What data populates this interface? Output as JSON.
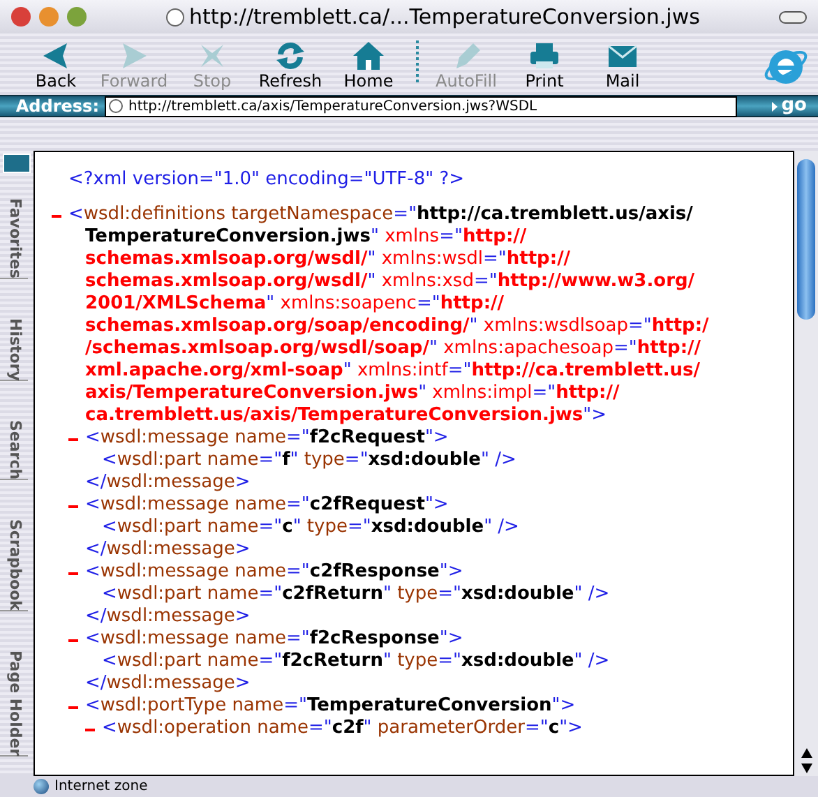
{
  "window": {
    "title": "http://tremblett.ca/...TemperatureConversion.jws"
  },
  "toolbar": [
    {
      "label": "Back",
      "kind": "back",
      "disabled": false
    },
    {
      "label": "Forward",
      "kind": "forward",
      "disabled": true
    },
    {
      "label": "Stop",
      "kind": "stop",
      "disabled": true
    },
    {
      "label": "Refresh",
      "kind": "refresh",
      "disabled": false
    },
    {
      "label": "Home",
      "kind": "home",
      "disabled": false
    },
    {
      "label": "AutoFill",
      "kind": "autofill",
      "disabled": true
    },
    {
      "label": "Print",
      "kind": "print",
      "disabled": false
    },
    {
      "label": "Mail",
      "kind": "mail",
      "disabled": false
    }
  ],
  "address": {
    "label": "Address:",
    "value": "http://tremblett.ca/axis/TemperatureConversion.jws?WSDL",
    "go": "go"
  },
  "sidebar_tabs": [
    {
      "label": "Favorites"
    },
    {
      "label": "History"
    },
    {
      "label": "Search"
    },
    {
      "label": "Scrapbook"
    },
    {
      "label": "Page Holder"
    }
  ],
  "document": [
    {
      "collapsible": false,
      "lines": [
        [
          {
            "kind": "tag",
            "text": "<?xml version=\"1.0\" encoding=\"UTF-8\" ?>"
          }
        ]
      ]
    },
    {
      "collapsible": true,
      "lines": [
        [
          {
            "kind": "tag",
            "text": "<"
          },
          {
            "kind": "attr",
            "text": "wsdl:definitions targetNamespace"
          },
          {
            "kind": "tag",
            "text": "=\""
          },
          {
            "kind": "value",
            "text": "http://ca.tremblett.us/axis/"
          }
        ],
        [
          {
            "kind": "value",
            "text": "TemperatureConversion.jws"
          },
          {
            "kind": "tag",
            "text": "\""
          },
          {
            "kind": "ns_attr",
            "text": " xmlns"
          },
          {
            "kind": "tag",
            "text": "=\""
          },
          {
            "kind": "ns_value",
            "text": "http://"
          }
        ],
        [
          {
            "kind": "ns_value",
            "text": "schemas.xmlsoap.org/wsdl/"
          },
          {
            "kind": "tag",
            "text": "\""
          },
          {
            "kind": "ns_attr",
            "text": " xmlns:wsdl"
          },
          {
            "kind": "tag",
            "text": "=\""
          },
          {
            "kind": "ns_value",
            "text": "http://"
          }
        ],
        [
          {
            "kind": "ns_value",
            "text": "schemas.xmlsoap.org/wsdl/"
          },
          {
            "kind": "tag",
            "text": "\""
          },
          {
            "kind": "ns_attr",
            "text": " xmlns:xsd"
          },
          {
            "kind": "tag",
            "text": "=\""
          },
          {
            "kind": "ns_value",
            "text": "http://www.w3.org/"
          }
        ],
        [
          {
            "kind": "ns_value",
            "text": "2001/XMLSchema"
          },
          {
            "kind": "tag",
            "text": "\""
          },
          {
            "kind": "ns_attr",
            "text": " xmlns:soapenc"
          },
          {
            "kind": "tag",
            "text": "=\""
          },
          {
            "kind": "ns_value",
            "text": "http://"
          }
        ],
        [
          {
            "kind": "ns_value",
            "text": "schemas.xmlsoap.org/soap/encoding/"
          },
          {
            "kind": "tag",
            "text": "\""
          },
          {
            "kind": "ns_attr",
            "text": " xmlns:wsdlsoap"
          },
          {
            "kind": "tag",
            "text": "=\""
          },
          {
            "kind": "ns_value",
            "text": "http:/"
          }
        ],
        [
          {
            "kind": "ns_value",
            "text": "/schemas.xmlsoap.org/wsdl/soap/"
          },
          {
            "kind": "tag",
            "text": "\""
          },
          {
            "kind": "ns_attr",
            "text": " xmlns:apachesoap"
          },
          {
            "kind": "tag",
            "text": "=\""
          },
          {
            "kind": "ns_value",
            "text": "http://"
          }
        ],
        [
          {
            "kind": "ns_value",
            "text": "xml.apache.org/xml-soap"
          },
          {
            "kind": "tag",
            "text": "\""
          },
          {
            "kind": "ns_attr",
            "text": " xmlns:intf"
          },
          {
            "kind": "tag",
            "text": "=\""
          },
          {
            "kind": "ns_value",
            "text": "http://ca.tremblett.us/"
          }
        ],
        [
          {
            "kind": "ns_value",
            "text": "axis/TemperatureConversion.jws"
          },
          {
            "kind": "tag",
            "text": "\""
          },
          {
            "kind": "ns_attr",
            "text": " xmlns:impl"
          },
          {
            "kind": "tag",
            "text": "=\""
          },
          {
            "kind": "ns_value",
            "text": "http://"
          }
        ],
        [
          {
            "kind": "ns_value",
            "text": "ca.tremblett.us/axis/TemperatureConversion.jws"
          },
          {
            "kind": "tag",
            "text": "\">"
          }
        ]
      ],
      "children": [
        {
          "collapsible": true,
          "lines": [
            [
              {
                "kind": "tag",
                "text": "<"
              },
              {
                "kind": "attr",
                "text": "wsdl:message name"
              },
              {
                "kind": "tag",
                "text": "=\""
              },
              {
                "kind": "value",
                "text": "f2cRequest"
              },
              {
                "kind": "tag",
                "text": "\">"
              }
            ]
          ],
          "children": [
            {
              "collapsible": false,
              "lines": [
                [
                  {
                    "kind": "tag",
                    "text": "<"
                  },
                  {
                    "kind": "attr",
                    "text": "wsdl:part name"
                  },
                  {
                    "kind": "tag",
                    "text": "=\""
                  },
                  {
                    "kind": "value",
                    "text": "f"
                  },
                  {
                    "kind": "tag",
                    "text": "\""
                  },
                  {
                    "kind": "attr",
                    "text": " type"
                  },
                  {
                    "kind": "tag",
                    "text": "=\""
                  },
                  {
                    "kind": "value",
                    "text": "xsd:double"
                  },
                  {
                    "kind": "tag",
                    "text": "\" />"
                  }
                ]
              ]
            }
          ],
          "close": [
            {
              "kind": "tag",
              "text": "</"
            },
            {
              "kind": "attr",
              "text": "wsdl:message"
            },
            {
              "kind": "tag",
              "text": ">"
            }
          ]
        },
        {
          "collapsible": true,
          "lines": [
            [
              {
                "kind": "tag",
                "text": "<"
              },
              {
                "kind": "attr",
                "text": "wsdl:message name"
              },
              {
                "kind": "tag",
                "text": "=\""
              },
              {
                "kind": "value",
                "text": "c2fRequest"
              },
              {
                "kind": "tag",
                "text": "\">"
              }
            ]
          ],
          "children": [
            {
              "collapsible": false,
              "lines": [
                [
                  {
                    "kind": "tag",
                    "text": "<"
                  },
                  {
                    "kind": "attr",
                    "text": "wsdl:part name"
                  },
                  {
                    "kind": "tag",
                    "text": "=\""
                  },
                  {
                    "kind": "value",
                    "text": "c"
                  },
                  {
                    "kind": "tag",
                    "text": "\""
                  },
                  {
                    "kind": "attr",
                    "text": " type"
                  },
                  {
                    "kind": "tag",
                    "text": "=\""
                  },
                  {
                    "kind": "value",
                    "text": "xsd:double"
                  },
                  {
                    "kind": "tag",
                    "text": "\" />"
                  }
                ]
              ]
            }
          ],
          "close": [
            {
              "kind": "tag",
              "text": "</"
            },
            {
              "kind": "attr",
              "text": "wsdl:message"
            },
            {
              "kind": "tag",
              "text": ">"
            }
          ]
        },
        {
          "collapsible": true,
          "lines": [
            [
              {
                "kind": "tag",
                "text": "<"
              },
              {
                "kind": "attr",
                "text": "wsdl:message name"
              },
              {
                "kind": "tag",
                "text": "=\""
              },
              {
                "kind": "value",
                "text": "c2fResponse"
              },
              {
                "kind": "tag",
                "text": "\">"
              }
            ]
          ],
          "children": [
            {
              "collapsible": false,
              "lines": [
                [
                  {
                    "kind": "tag",
                    "text": "<"
                  },
                  {
                    "kind": "attr",
                    "text": "wsdl:part name"
                  },
                  {
                    "kind": "tag",
                    "text": "=\""
                  },
                  {
                    "kind": "value",
                    "text": "c2fReturn"
                  },
                  {
                    "kind": "tag",
                    "text": "\""
                  },
                  {
                    "kind": "attr",
                    "text": " type"
                  },
                  {
                    "kind": "tag",
                    "text": "=\""
                  },
                  {
                    "kind": "value",
                    "text": "xsd:double"
                  },
                  {
                    "kind": "tag",
                    "text": "\" />"
                  }
                ]
              ]
            }
          ],
          "close": [
            {
              "kind": "tag",
              "text": "</"
            },
            {
              "kind": "attr",
              "text": "wsdl:message"
            },
            {
              "kind": "tag",
              "text": ">"
            }
          ]
        },
        {
          "collapsible": true,
          "lines": [
            [
              {
                "kind": "tag",
                "text": "<"
              },
              {
                "kind": "attr",
                "text": "wsdl:message name"
              },
              {
                "kind": "tag",
                "text": "=\""
              },
              {
                "kind": "value",
                "text": "f2cResponse"
              },
              {
                "kind": "tag",
                "text": "\">"
              }
            ]
          ],
          "children": [
            {
              "collapsible": false,
              "lines": [
                [
                  {
                    "kind": "tag",
                    "text": "<"
                  },
                  {
                    "kind": "attr",
                    "text": "wsdl:part name"
                  },
                  {
                    "kind": "tag",
                    "text": "=\""
                  },
                  {
                    "kind": "value",
                    "text": "f2cReturn"
                  },
                  {
                    "kind": "tag",
                    "text": "\""
                  },
                  {
                    "kind": "attr",
                    "text": " type"
                  },
                  {
                    "kind": "tag",
                    "text": "=\""
                  },
                  {
                    "kind": "value",
                    "text": "xsd:double"
                  },
                  {
                    "kind": "tag",
                    "text": "\" />"
                  }
                ]
              ]
            }
          ],
          "close": [
            {
              "kind": "tag",
              "text": "</"
            },
            {
              "kind": "attr",
              "text": "wsdl:message"
            },
            {
              "kind": "tag",
              "text": ">"
            }
          ]
        },
        {
          "collapsible": true,
          "lines": [
            [
              {
                "kind": "tag",
                "text": "<"
              },
              {
                "kind": "attr",
                "text": "wsdl:portType name"
              },
              {
                "kind": "tag",
                "text": "=\""
              },
              {
                "kind": "value",
                "text": "TemperatureConversion"
              },
              {
                "kind": "tag",
                "text": "\">"
              }
            ]
          ],
          "children": [
            {
              "collapsible": true,
              "lines": [
                [
                  {
                    "kind": "tag",
                    "text": "<"
                  },
                  {
                    "kind": "attr",
                    "text": "wsdl:operation name"
                  },
                  {
                    "kind": "tag",
                    "text": "=\""
                  },
                  {
                    "kind": "value",
                    "text": "c2f"
                  },
                  {
                    "kind": "tag",
                    "text": "\""
                  },
                  {
                    "kind": "attr",
                    "text": " parameterOrder"
                  },
                  {
                    "kind": "tag",
                    "text": "=\""
                  },
                  {
                    "kind": "value",
                    "text": "c"
                  },
                  {
                    "kind": "tag",
                    "text": "\">"
                  }
                ]
              ]
            }
          ]
        }
      ]
    }
  ],
  "status_bar": {
    "text": "Internet zone"
  }
}
